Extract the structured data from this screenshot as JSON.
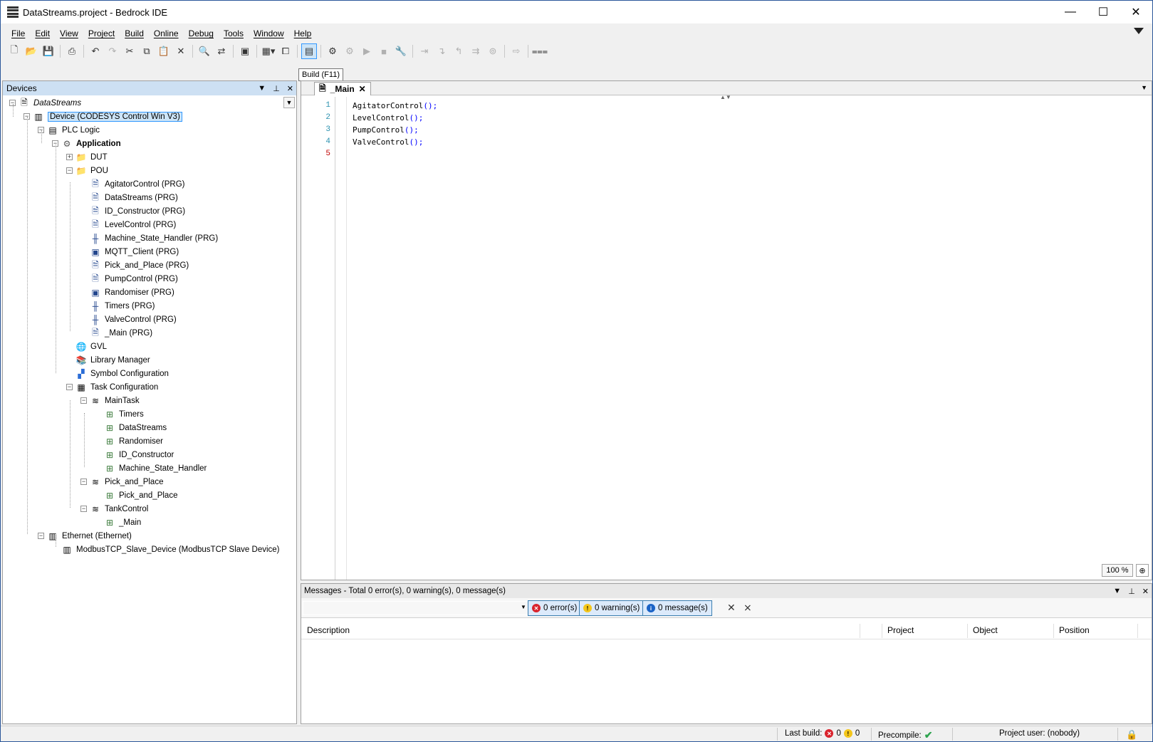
{
  "window": {
    "title": "DataStreams.project - Bedrock IDE",
    "minimize": "—",
    "maximize": "☐",
    "close": "✕"
  },
  "menu": [
    "File",
    "Edit",
    "View",
    "Project",
    "Build",
    "Online",
    "Debug",
    "Tools",
    "Window",
    "Help"
  ],
  "tooltip": "Build (F11)",
  "devices": {
    "title": "Devices",
    "tree": [
      {
        "label": "DataStreams",
        "level": 0,
        "icon": "project-icon",
        "expander": "−",
        "italic": true
      },
      {
        "label": "Device (CODESYS Control Win V3)",
        "level": 1,
        "icon": "device-icon",
        "expander": "−",
        "selected": true
      },
      {
        "label": "PLC Logic",
        "level": 2,
        "icon": "plc-logic-icon",
        "expander": "−"
      },
      {
        "label": "Application",
        "level": 3,
        "icon": "application-gear-icon",
        "expander": "−",
        "bold": true
      },
      {
        "label": "DUT",
        "level": 4,
        "icon": "folder-icon",
        "expander": "+"
      },
      {
        "label": "POU",
        "level": 4,
        "icon": "folder-icon",
        "expander": "−"
      },
      {
        "label": "AgitatorControl (PRG)",
        "level": 5,
        "icon": "pou-icon"
      },
      {
        "label": "DataStreams (PRG)",
        "level": 5,
        "icon": "pou-icon"
      },
      {
        "label": "ID_Constructor (PRG)",
        "level": 5,
        "icon": "pou-icon"
      },
      {
        "label": "LevelControl (PRG)",
        "level": 5,
        "icon": "pou-icon"
      },
      {
        "label": "Machine_State_Handler (PRG)",
        "level": 5,
        "icon": "pou-ladder-icon"
      },
      {
        "label": "MQTT_Client (PRG)",
        "level": 5,
        "icon": "pou-fbd-icon"
      },
      {
        "label": "Pick_and_Place (PRG)",
        "level": 5,
        "icon": "pou-icon"
      },
      {
        "label": "PumpControl (PRG)",
        "level": 5,
        "icon": "pou-icon"
      },
      {
        "label": "Randomiser (PRG)",
        "level": 5,
        "icon": "pou-fbd-icon"
      },
      {
        "label": "Timers (PRG)",
        "level": 5,
        "icon": "pou-ladder-icon"
      },
      {
        "label": "ValveControl (PRG)",
        "level": 5,
        "icon": "pou-ladder-icon"
      },
      {
        "label": "_Main (PRG)",
        "level": 5,
        "icon": "pou-icon"
      },
      {
        "label": "GVL",
        "level": 4,
        "icon": "globe-icon"
      },
      {
        "label": "Library Manager",
        "level": 4,
        "icon": "library-icon"
      },
      {
        "label": "Symbol Configuration",
        "level": 4,
        "icon": "symbol-config-icon"
      },
      {
        "label": "Task Configuration",
        "level": 4,
        "icon": "task-config-icon",
        "expander": "−"
      },
      {
        "label": "MainTask",
        "level": 5,
        "icon": "task-icon",
        "expander": "−"
      },
      {
        "label": "Timers",
        "level": 6,
        "icon": "program-call-icon"
      },
      {
        "label": "DataStreams",
        "level": 6,
        "icon": "program-call-icon"
      },
      {
        "label": "Randomiser",
        "level": 6,
        "icon": "program-call-icon"
      },
      {
        "label": "ID_Constructor",
        "level": 6,
        "icon": "program-call-icon"
      },
      {
        "label": "Machine_State_Handler",
        "level": 6,
        "icon": "program-call-icon"
      },
      {
        "label": "Pick_and_Place",
        "level": 5,
        "icon": "task-icon",
        "expander": "−"
      },
      {
        "label": "Pick_and_Place",
        "level": 6,
        "icon": "program-call-icon"
      },
      {
        "label": "TankControl",
        "level": 5,
        "icon": "task-icon",
        "expander": "−"
      },
      {
        "label": "_Main",
        "level": 6,
        "icon": "program-call-icon"
      },
      {
        "label": "Ethernet (Ethernet)",
        "level": 2,
        "icon": "device-icon",
        "expander": "−"
      },
      {
        "label": "ModbusTCP_Slave_Device (ModbusTCP Slave Device)",
        "level": 3,
        "icon": "device-icon"
      }
    ]
  },
  "editor": {
    "tab_label": "_Main",
    "lines": [
      {
        "num": "1",
        "name": "AgitatorControl",
        "call": "();"
      },
      {
        "num": "2",
        "name": "LevelControl",
        "call": "();"
      },
      {
        "num": "3",
        "name": "PumpControl",
        "call": "();"
      },
      {
        "num": "4",
        "name": "ValveControl",
        "call": "();"
      },
      {
        "num": "5",
        "name": "",
        "call": ""
      }
    ],
    "zoom": "100 %"
  },
  "messages": {
    "title": "Messages - Total 0 error(s), 0 warning(s), 0 message(s)",
    "errors": "0 error(s)",
    "warnings": "0 warning(s)",
    "infos": "0 message(s)",
    "columns": [
      "Description",
      "Project",
      "Object",
      "Position"
    ]
  },
  "status": {
    "last_build_label": "Last build:",
    "errors": "0",
    "warnings": "0",
    "precompile_label": "Precompile:",
    "project_user": "Project user: (nobody)"
  }
}
